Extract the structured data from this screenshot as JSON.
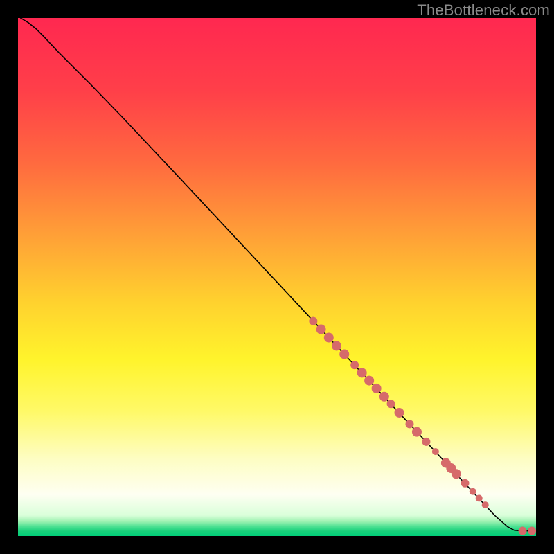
{
  "attribution": "TheBottleneck.com",
  "chart_data": {
    "type": "line",
    "title": "",
    "xlabel": "",
    "ylabel": "",
    "xlim": [
      0,
      100
    ],
    "ylim": [
      0,
      100
    ],
    "grid": false,
    "background_gradient": {
      "stops": [
        {
          "offset": 0,
          "color": "#ff2850"
        },
        {
          "offset": 14,
          "color": "#ff3f49"
        },
        {
          "offset": 28,
          "color": "#ff6a3f"
        },
        {
          "offset": 42,
          "color": "#ffa037"
        },
        {
          "offset": 55,
          "color": "#ffd22e"
        },
        {
          "offset": 66,
          "color": "#fff42c"
        },
        {
          "offset": 76,
          "color": "#fff968"
        },
        {
          "offset": 85,
          "color": "#fdfdc2"
        },
        {
          "offset": 92,
          "color": "#fefff2"
        },
        {
          "offset": 96.0,
          "color": "#daffda"
        },
        {
          "offset": 97.2,
          "color": "#9ef2b2"
        },
        {
          "offset": 98.2,
          "color": "#4be092"
        },
        {
          "offset": 99.1,
          "color": "#17d07a"
        },
        {
          "offset": 100,
          "color": "#00ce79"
        }
      ]
    },
    "series": [
      {
        "name": "bottleneck-curve",
        "type": "line",
        "color": "#000000",
        "width": 1.6,
        "points": [
          {
            "x": 0.5,
            "y": 100.0
          },
          {
            "x": 2.0,
            "y": 99.1
          },
          {
            "x": 3.5,
            "y": 97.9
          },
          {
            "x": 5.0,
            "y": 96.4
          },
          {
            "x": 6.5,
            "y": 94.8
          },
          {
            "x": 8.0,
            "y": 93.2
          },
          {
            "x": 10.0,
            "y": 91.2
          },
          {
            "x": 14.0,
            "y": 87.2
          },
          {
            "x": 20.0,
            "y": 81.0
          },
          {
            "x": 30.0,
            "y": 70.4
          },
          {
            "x": 40.0,
            "y": 59.7
          },
          {
            "x": 50.0,
            "y": 49.0
          },
          {
            "x": 60.0,
            "y": 38.3
          },
          {
            "x": 70.0,
            "y": 27.6
          },
          {
            "x": 80.0,
            "y": 16.9
          },
          {
            "x": 88.0,
            "y": 8.3
          },
          {
            "x": 92.0,
            "y": 4.0
          },
          {
            "x": 94.5,
            "y": 1.8
          },
          {
            "x": 95.8,
            "y": 1.1
          },
          {
            "x": 97.2,
            "y": 1.0
          },
          {
            "x": 99.5,
            "y": 1.0
          }
        ]
      },
      {
        "name": "marker-dots",
        "type": "scatter",
        "color": "#d66a6a",
        "points": [
          {
            "x": 57.0,
            "y": 41.5,
            "r": 6
          },
          {
            "x": 58.5,
            "y": 39.9,
            "r": 7
          },
          {
            "x": 60.0,
            "y": 38.3,
            "r": 7
          },
          {
            "x": 61.5,
            "y": 36.7,
            "r": 7
          },
          {
            "x": 63.0,
            "y": 35.1,
            "r": 7
          },
          {
            "x": 65.0,
            "y": 33.0,
            "r": 6
          },
          {
            "x": 66.4,
            "y": 31.5,
            "r": 7
          },
          {
            "x": 67.8,
            "y": 30.0,
            "r": 7
          },
          {
            "x": 69.2,
            "y": 28.5,
            "r": 7
          },
          {
            "x": 70.7,
            "y": 26.9,
            "r": 7
          },
          {
            "x": 72.0,
            "y": 25.5,
            "r": 6
          },
          {
            "x": 73.6,
            "y": 23.8,
            "r": 7
          },
          {
            "x": 75.6,
            "y": 21.6,
            "r": 6
          },
          {
            "x": 77.0,
            "y": 20.1,
            "r": 7
          },
          {
            "x": 78.8,
            "y": 18.2,
            "r": 6
          },
          {
            "x": 80.6,
            "y": 16.3,
            "r": 5
          },
          {
            "x": 82.6,
            "y": 14.1,
            "r": 7
          },
          {
            "x": 83.6,
            "y": 13.1,
            "r": 7
          },
          {
            "x": 84.6,
            "y": 12.0,
            "r": 7
          },
          {
            "x": 86.3,
            "y": 10.2,
            "r": 6
          },
          {
            "x": 87.8,
            "y": 8.6,
            "r": 5
          },
          {
            "x": 89.0,
            "y": 7.3,
            "r": 5
          },
          {
            "x": 90.2,
            "y": 6.0,
            "r": 5
          },
          {
            "x": 97.4,
            "y": 1.0,
            "r": 6
          },
          {
            "x": 99.2,
            "y": 1.0,
            "r": 6
          }
        ]
      }
    ]
  }
}
